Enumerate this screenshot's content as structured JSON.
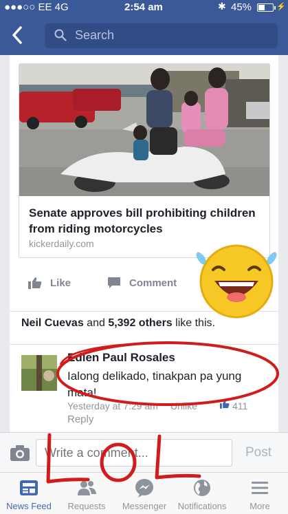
{
  "status_bar": {
    "carrier": "●●●○○ EE  4G",
    "time": "2:54 am",
    "battery_text": "45%",
    "battery_level": 0.45
  },
  "nav": {
    "search_placeholder": "Search"
  },
  "post": {
    "link": {
      "headline": "Senate approves bill prohibiting children from riding motorcycles",
      "domain": "kickerdaily.com"
    },
    "actions": {
      "like_label": "Like",
      "comment_label": "Comment"
    },
    "likes": {
      "first_name": "Neil Cuevas",
      "connector": " and ",
      "others_count": "5,392 others",
      "suffix": " like this."
    },
    "comment": {
      "author": "Edlen Paul Rosales",
      "text": "Ialong delikado, tinakpan pa yung mata!",
      "time": "Yesterday at 7:29 am",
      "unlike_label": "Unlike",
      "like_count": "411",
      "reply_label": "Reply"
    }
  },
  "composer": {
    "placeholder": "Write a comment...",
    "post_label": "Post"
  },
  "tabs": [
    {
      "label": "News Feed",
      "icon": "news-feed-icon",
      "active": true
    },
    {
      "label": "Requests",
      "icon": "friend-requests-icon",
      "active": false
    },
    {
      "label": "Messenger",
      "icon": "messenger-icon",
      "active": false
    },
    {
      "label": "Notifications",
      "icon": "globe-icon",
      "active": false
    },
    {
      "label": "More",
      "icon": "menu-icon",
      "active": false
    }
  ],
  "overlay": {
    "annotation_text": "LOL",
    "annotation_color": "#d11c1c",
    "emoji": "laughing-tears-emoji"
  },
  "colors": {
    "facebook_blue": "#3b5998",
    "active_tab": "#4267b2"
  }
}
